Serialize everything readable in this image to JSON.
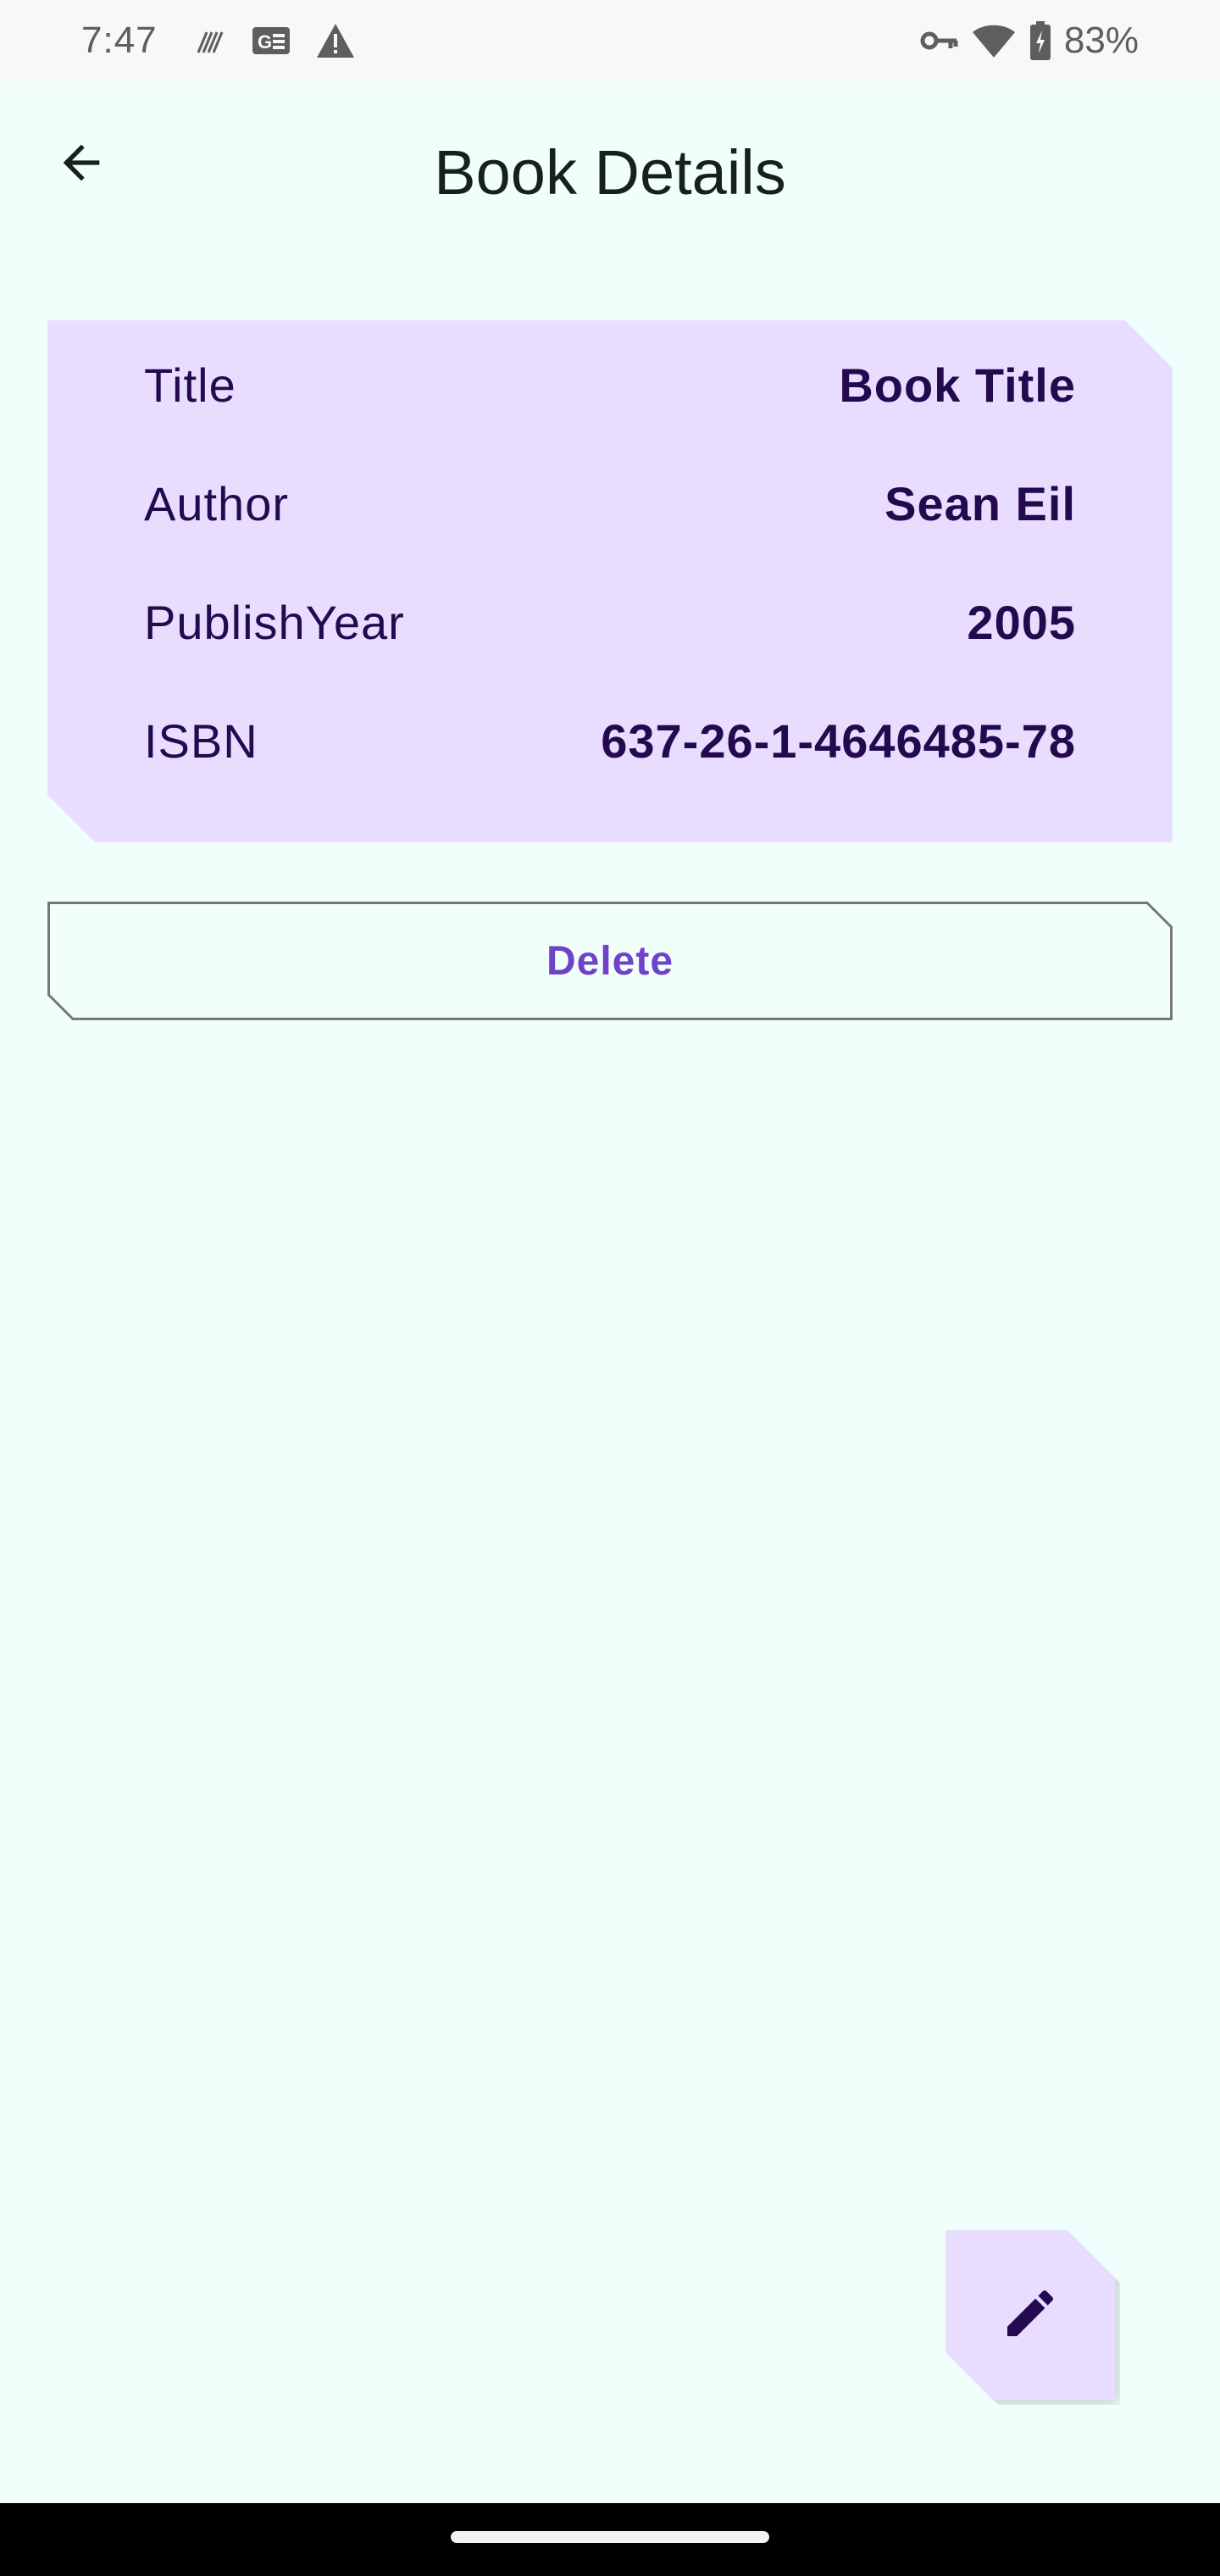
{
  "status_bar": {
    "time": "7:47",
    "battery_percent": "83%",
    "left_icons": [
      "signal-stripes-icon",
      "ge-news-icon",
      "warning-icon"
    ],
    "right_icons": [
      "vpn-key-icon",
      "wifi-icon",
      "battery-charging-icon"
    ]
  },
  "app_bar": {
    "title": "Book Details",
    "back_icon": "arrow-back-icon"
  },
  "book": {
    "rows": [
      {
        "label": "Title",
        "value": "Book Title"
      },
      {
        "label": "Author",
        "value": "Sean Eil"
      },
      {
        "label": "PublishYear",
        "value": "2005"
      },
      {
        "label": "ISBN",
        "value": "637-26-1-4646485-78"
      }
    ]
  },
  "actions": {
    "delete_label": "Delete",
    "edit_icon": "edit-pencil-icon"
  },
  "colors": {
    "background": "#F1FFFC",
    "card": "#E8DDFE",
    "on_card": "#230A4F",
    "primary": "#6E43C8",
    "title_text": "#16211F",
    "outline": "#767676"
  }
}
